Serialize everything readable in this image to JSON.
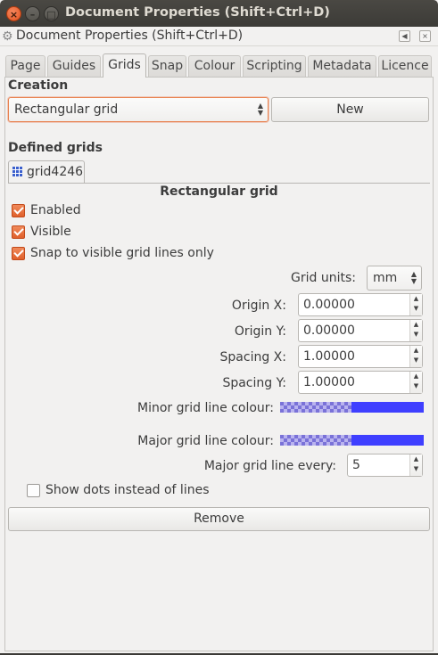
{
  "window": {
    "title": "Document Properties (Shift+Ctrl+D)",
    "close_glyph": "×",
    "min_glyph": "–",
    "max_glyph": "□"
  },
  "dock": {
    "title": "Document Properties (Shift+Ctrl+D)",
    "icons": [
      "gear-icon",
      "dock-left-icon",
      "close-icon"
    ],
    "close_glyph": "×"
  },
  "tabs": [
    {
      "label": "Page"
    },
    {
      "label": "Guides"
    },
    {
      "label": "Grids",
      "active": true
    },
    {
      "label": "Snap"
    },
    {
      "label": "Colour"
    },
    {
      "label": "Scripting"
    },
    {
      "label": "Metadata"
    },
    {
      "label": "Licence"
    }
  ],
  "creation": {
    "heading": "Creation",
    "grid_type": "Rectangular grid",
    "new_label": "New"
  },
  "defined_grids": {
    "heading": "Defined grids",
    "grid_tab": "grid4246"
  },
  "grid": {
    "heading": "Rectangular grid",
    "enabled_label": "Enabled",
    "enabled": true,
    "visible_label": "Visible",
    "visible": true,
    "snap_label": "Snap to visible grid lines only",
    "snap": true,
    "units_label": "Grid units:",
    "units_value": "mm",
    "origin_x_label": "Origin X:",
    "origin_x": "0.00000",
    "origin_y_label": "Origin Y:",
    "origin_y": "0.00000",
    "spacing_x_label": "Spacing X:",
    "spacing_x": "1.00000",
    "spacing_y_label": "Spacing Y:",
    "spacing_y": "1.00000",
    "minor_color_label": "Minor grid line colour:",
    "minor_color": "#3f3fff",
    "major_color_label": "Major grid line colour:",
    "major_color": "#3f3fff",
    "major_every_label": "Major grid line every:",
    "major_every": "5",
    "dots_label": "Show dots instead of lines",
    "dots": false
  },
  "remove_label": "Remove",
  "colors": {
    "accent": "#e95420",
    "titlebar": "#3c3b37"
  }
}
